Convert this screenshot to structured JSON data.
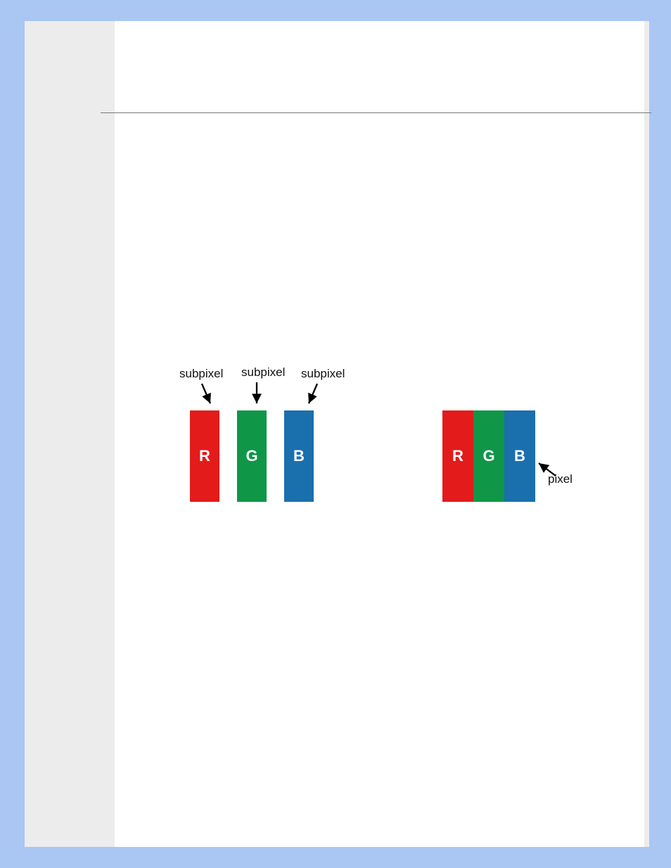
{
  "diagram": {
    "subpixels": [
      {
        "label": "subpixel",
        "letter": "R",
        "color": "#e31b1b"
      },
      {
        "label": "subpixel",
        "letter": "G",
        "color": "#0f9647"
      },
      {
        "label": "subpixel",
        "letter": "B",
        "color": "#1a6fad"
      }
    ],
    "pixel": {
      "label": "pixel",
      "letters": [
        "R",
        "G",
        "B"
      ],
      "colors": [
        "#e31b1b",
        "#0f9647",
        "#1a6fad"
      ]
    }
  }
}
